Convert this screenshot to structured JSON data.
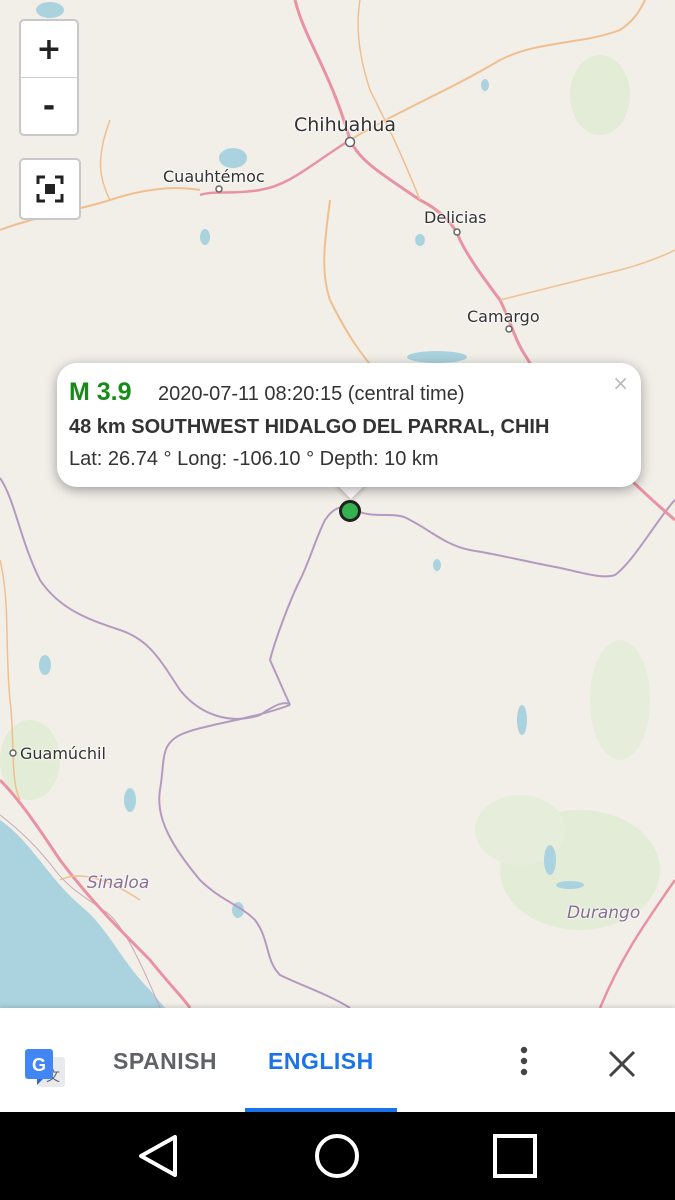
{
  "map": {
    "cities": [
      {
        "name": "Chihuahua"
      },
      {
        "name": "Cuauhtémoc"
      },
      {
        "name": "Delicias"
      },
      {
        "name": "Camargo"
      },
      {
        "name": "Guamúchil"
      }
    ],
    "states": [
      {
        "name": "Sinaloa"
      },
      {
        "name": "Durango"
      }
    ],
    "controls": {
      "zoom_in": "+",
      "zoom_out": "-"
    }
  },
  "popup": {
    "magnitude": "M 3.9",
    "time": "2020-07-11 08:20:15 (central time)",
    "location": "48 km SOUTHWEST HIDALGO DEL PARRAL, CHIH",
    "coords": "Lat: 26.74 ° Long: -106.10 ° Depth: 10 km",
    "close": "×"
  },
  "translate_bar": {
    "source_lang": "SPANISH",
    "target_lang": "ENGLISH",
    "active": "ENGLISH"
  },
  "colors": {
    "magnitude": "#178a17",
    "marker": "#34b250",
    "accent": "#1a73e8",
    "inactive": "#5f6368"
  },
  "icons": {
    "translate": "google-translate-icon",
    "more": "more-vert-icon",
    "close": "close-icon",
    "fullscreen": "fullscreen-icon",
    "nav_back": "back-triangle-icon",
    "nav_home": "home-circle-icon",
    "nav_recents": "recents-square-icon"
  }
}
